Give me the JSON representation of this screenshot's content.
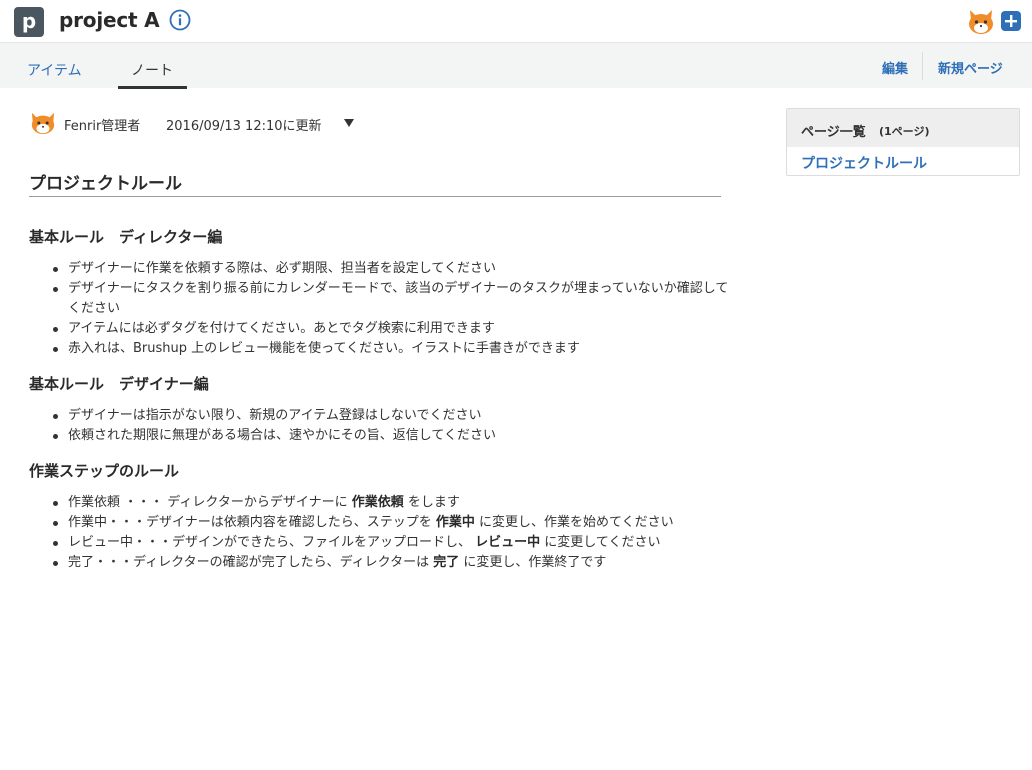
{
  "header": {
    "project_initial": "p",
    "project_name": "project A",
    "info_icon": "info-circle-icon",
    "add_icon": "plus-icon"
  },
  "tabs": [
    {
      "label": "アイテム",
      "active": false
    },
    {
      "label": "ノート",
      "active": true
    }
  ],
  "actions": {
    "edit_label": "編集",
    "new_page_label": "新規ページ"
  },
  "note": {
    "author": "Fenrir管理者",
    "updated": "2016/09/13 12:10に更新",
    "title": "プロジェクトルール",
    "sections": [
      {
        "heading": "基本ルール　ディレクター編",
        "items": [
          "デザイナーに作業を依頼する際は、必ず期限、担当者を設定してください",
          "デザイナーにタスクを割り振る前にカレンダーモードで、該当のデザイナーのタスクが埋まっていないか確認してください",
          "アイテムには必ずタグを付けてください。あとでタグ検索に利用できます",
          "赤入れは、Brushup 上のレビュー機能を使ってください。イラストに手書きができます"
        ]
      },
      {
        "heading": "基本ルール　デザイナー編",
        "items": [
          "デザイナーは指示がない限り、新規のアイテム登録はしないでください",
          "依頼された期限に無理がある場合は、速やかにその旨、返信してください"
        ]
      },
      {
        "heading": "作業ステップのルール",
        "steps": [
          {
            "pre": "作業依頼 ・・・ ディレクターからデザイナーに ",
            "bold": "作業依頼",
            "post": " をします"
          },
          {
            "pre": "作業中・・・デザイナーは依頼内容を確認したら、ステップを ",
            "bold": "作業中",
            "post": " に変更し、作業を始めてください"
          },
          {
            "pre": "レビュー中・・・デザインができたら、ファイルをアップロードし、 ",
            "bold": "レビュー中",
            "post": " に変更してください"
          },
          {
            "pre": "完了・・・ディレクターの確認が完了したら、ディレクターは ",
            "bold": "完了",
            "post": " に変更し、作業終了です"
          }
        ]
      }
    ]
  },
  "page_list": {
    "title": "ページ一覧",
    "count": "(1ページ)",
    "pages": [
      "プロジェクトルール"
    ]
  },
  "colors": {
    "accent": "#2e6fb8",
    "avatar_orange": "#f08c2a",
    "project_avatar": "#4a5660"
  }
}
